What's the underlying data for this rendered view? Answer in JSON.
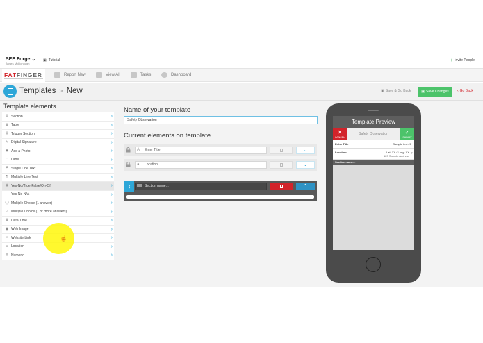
{
  "topbar": {
    "workspace": "SEE Forge",
    "workspace_user": "James McDonough",
    "tutorial": "Tutorial",
    "invite": "Invite People"
  },
  "nav": {
    "logo_part1": "FAT",
    "logo_part2": "FINGER",
    "items": [
      {
        "label": "Report New",
        "icon": "pencil-icon"
      },
      {
        "label": "View All",
        "icon": "document-icon"
      },
      {
        "label": "Tasks",
        "icon": "tasks-icon"
      },
      {
        "label": "Dashboard",
        "icon": "dashboard-icon"
      }
    ]
  },
  "page": {
    "title": "Templates",
    "separator": ">",
    "subtitle": "New",
    "save_and_go_back": "Save & Go Back",
    "save_changes": "Save Changes",
    "go_back": "Go Back"
  },
  "left": {
    "title": "Template elements",
    "items": [
      {
        "label": "Section",
        "icon": "section-icon"
      },
      {
        "label": "Table",
        "icon": "table-icon"
      },
      {
        "label": "Trigger Section",
        "icon": "trigger-icon"
      },
      {
        "label": "Digital Signature",
        "icon": "signature-icon"
      },
      {
        "label": "Add a Photo",
        "icon": "photo-icon"
      },
      {
        "label": "Label",
        "icon": "quote-icon"
      },
      {
        "label": "Single Line Text",
        "icon": "text-icon"
      },
      {
        "label": "Multiple Line Text",
        "icon": "paragraph-icon"
      },
      {
        "label": "Yes-No/True-False/On-Off",
        "icon": "toggle-icon"
      },
      {
        "label": "Yes-No-N/A",
        "icon": "dots-icon"
      },
      {
        "label": "Multiple Choice (1 answer)",
        "icon": "radio-icon"
      },
      {
        "label": "Multiple Choice (1 or more answers)",
        "icon": "checkbox-icon"
      },
      {
        "label": "Date/Time",
        "icon": "calendar-icon"
      },
      {
        "label": "Web Image",
        "icon": "image-icon"
      },
      {
        "label": "Website Link",
        "icon": "link-icon"
      },
      {
        "label": "Location",
        "icon": "location-icon"
      },
      {
        "label": "Numeric",
        "icon": "hash-icon"
      }
    ]
  },
  "center": {
    "name_heading": "Name of your template",
    "template_name": "Safety Observation",
    "current_heading": "Current elements on template",
    "elements": [
      {
        "label": "Enter Title",
        "icon": "text-icon"
      },
      {
        "label": "Location",
        "icon": "location-icon"
      }
    ],
    "section_placeholder": "Section name..."
  },
  "preview": {
    "title": "Template Preview",
    "cancel": "CANCEL",
    "submit": "SUBMIT",
    "template_name": "Safety Observation",
    "rows": [
      {
        "label": "Enter Title",
        "value": "Sample text #1",
        "value2": ""
      },
      {
        "label": "Location",
        "value": "Lat: XX / Long: XX",
        "value2": "123 Sample Address"
      }
    ],
    "section": "Section name..."
  },
  "colors": {
    "accent": "#2ea7d8",
    "brand_red": "#d2232a",
    "save_green": "#4cc36a",
    "phone": "#4b4b4b"
  }
}
